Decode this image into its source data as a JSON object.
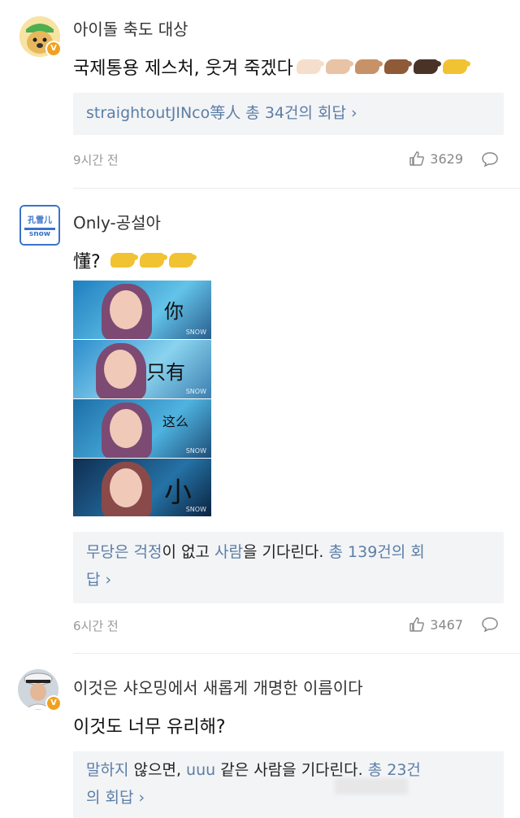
{
  "comments": [
    {
      "username": "아이돌 축도 대상",
      "text": "국제통용 제스처, 웃겨 죽겠다",
      "hand_colors": [
        "#f5dfcc",
        "#e8c3a6",
        "#c79268",
        "#8e5a38",
        "#4a3227",
        "#f1c232"
      ],
      "reply": {
        "name": "straightoutJINco等人",
        "count_text": "총 34건의 회답",
        "chevron": "›"
      },
      "time": "9시간 전",
      "likes": "3629",
      "avatar_badge": "V"
    },
    {
      "username": "Only-공설아",
      "text": "懂?",
      "hand_colors": [
        "#f1c232",
        "#f1c232",
        "#f1c232"
      ],
      "collage_captions": [
        "你",
        "只有",
        "这么",
        "小"
      ],
      "collage_tag": "SNOW",
      "reply": {
        "line1_parts": [
          "무당은",
          "걱정",
          "이 없고",
          "사람",
          "을 기다린다.",
          "총 139건의 회"
        ],
        "line2": "답",
        "chevron": "›"
      },
      "time": "6시간 전",
      "likes": "3467",
      "avatar_text_top": "孔雪儿",
      "avatar_text_bottom": "snow"
    },
    {
      "username": "이것은 샤오밍에서 새롭게 개명한 이름이다",
      "text": "이것도 너무 유리해?",
      "reply": {
        "line1_parts": [
          "말하지",
          "않으면,",
          "uuu",
          "같은 사람을 기다린다.",
          "총 23건"
        ],
        "line2": "의 회답",
        "chevron": "›"
      },
      "avatar_badge": "V"
    }
  ],
  "icons": {
    "like": "thumbs-up-icon",
    "reply": "speech-bubble-icon"
  }
}
